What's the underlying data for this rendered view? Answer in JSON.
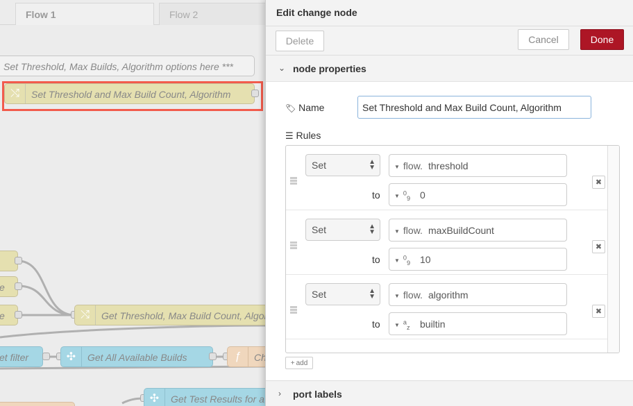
{
  "workspace": {
    "tabs": [
      {
        "label": "Flow 1"
      },
      {
        "label": "Flow 2"
      }
    ],
    "nodes": {
      "comment": "Set Threshold, Max Builds, Algorithm options here ***",
      "selected_change": "Set Threshold and Max Build Count, Algorithm",
      "left_node_2": "e",
      "left_node_3": "e",
      "get_threshold": "Get Threshold, Max Build Count, Algorithm",
      "filter": "et filter",
      "get_builds": "Get All Available Builds",
      "function_partial": "Ch",
      "get_test_results": "Get Test Results for a"
    }
  },
  "tray": {
    "title": "Edit change node",
    "delete_label": "Delete",
    "cancel_label": "Cancel",
    "done_label": "Done",
    "accent_color": "#ad1625",
    "props_section": "node properties",
    "name_label": "Name",
    "name_value": "Set Threshold and Max Build Count, Algorithm",
    "rules_label": "Rules",
    "to_label": "to",
    "rules": [
      {
        "action": "Set",
        "target_type": "flow.",
        "target": "threshold",
        "value_type": "num",
        "value": "0"
      },
      {
        "action": "Set",
        "target_type": "flow.",
        "target": "maxBuildCount",
        "value_type": "num",
        "value": "10"
      },
      {
        "action": "Set",
        "target_type": "flow.",
        "target": "algorithm",
        "value_type": "str",
        "value": "builtin"
      }
    ],
    "add_label": "add",
    "ports_section": "port labels"
  }
}
